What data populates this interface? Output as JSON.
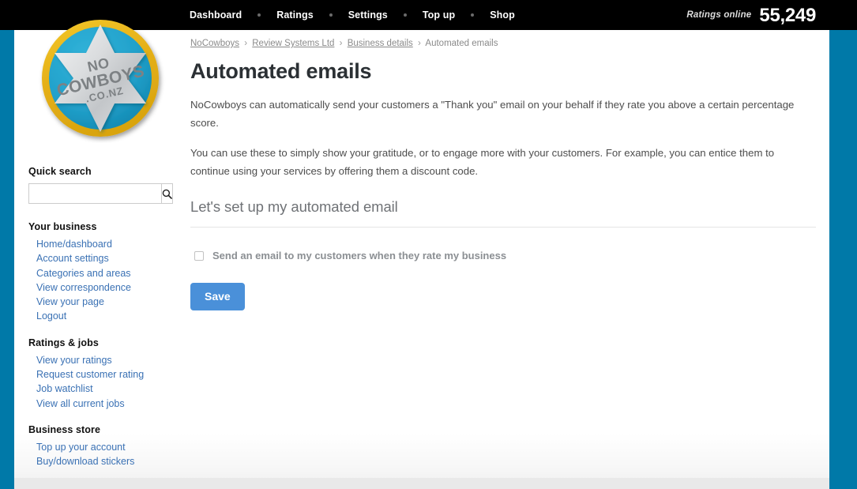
{
  "topbar": {
    "nav": [
      {
        "label": "Dashboard"
      },
      {
        "label": "Ratings"
      },
      {
        "label": "Settings"
      },
      {
        "label": "Top up"
      },
      {
        "label": "Shop"
      }
    ],
    "ratings_online_label": "Ratings online",
    "ratings_online_count": "55,249"
  },
  "logo": {
    "line1": "NO",
    "line2": "COWBOYS",
    "line3": ".CO.NZ",
    "ring_color": "#e8b520",
    "disc_color": "#23a3cc",
    "star_color": "#d6d8da"
  },
  "sidebar": {
    "quick_search_label": "Quick search",
    "search_value": "",
    "search_placeholder": "",
    "search_icon": "search-icon",
    "groups": [
      {
        "title": "Your business",
        "items": [
          {
            "label": "Home/dashboard"
          },
          {
            "label": "Account settings"
          },
          {
            "label": "Categories and areas"
          },
          {
            "label": "View correspondence"
          },
          {
            "label": "View your page"
          },
          {
            "label": "Logout"
          }
        ]
      },
      {
        "title": "Ratings & jobs",
        "items": [
          {
            "label": "View your ratings"
          },
          {
            "label": "Request customer rating"
          },
          {
            "label": "Job watchlist"
          },
          {
            "label": "View all current jobs"
          }
        ]
      },
      {
        "title": "Business store",
        "items": [
          {
            "label": "Top up your account"
          },
          {
            "label": "Buy/download stickers"
          }
        ]
      }
    ]
  },
  "main": {
    "breadcrumb": [
      {
        "label": "NoCowboys",
        "link": true
      },
      {
        "label": "Review Systems Ltd",
        "link": true
      },
      {
        "label": "Business details",
        "link": true
      },
      {
        "label": "Automated emails",
        "link": false
      }
    ],
    "breadcrumb_separator": "›",
    "title": "Automated emails",
    "paragraphs": [
      "NoCowboys can automatically send your customers a \"Thank you\" email on your behalf if they rate you above a certain percentage score.",
      "You can use these to simply show your gratitude, or to engage more with your customers. For example, you can entice them to continue using your services by offering them a discount code."
    ],
    "section_title": "Let's set up my automated email",
    "checkbox": {
      "label": "Send an email to my customers when they rate my business",
      "checked": false
    },
    "save_label": "Save"
  },
  "colors": {
    "accent_blue": "#4a90d9",
    "stripe_teal": "#0079a8",
    "link_blue": "#3a71b4",
    "topbar_black": "#000000"
  }
}
